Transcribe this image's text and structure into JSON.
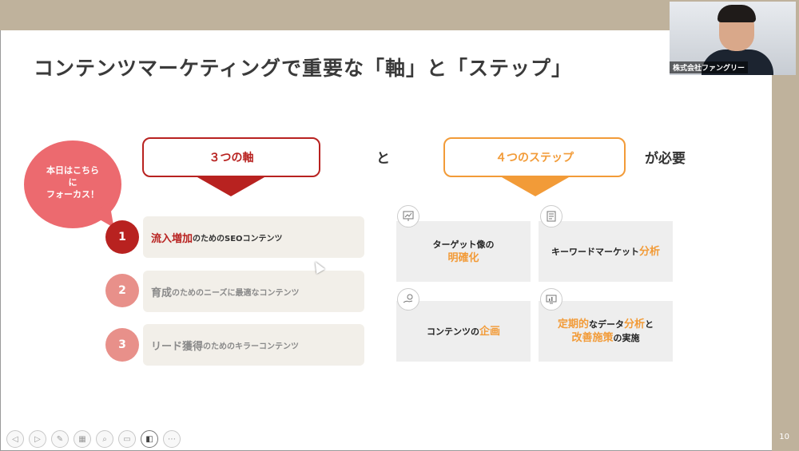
{
  "slide": {
    "title": "コンテンツマーケティングで重要な「軸」と「ステップ」",
    "page_number": "10"
  },
  "video": {
    "name": "株式会社ファングリー"
  },
  "bubble": {
    "line1": "本日はこちら",
    "line2": "に",
    "line3": "フォーカス！"
  },
  "axes": {
    "heading": "３つの軸",
    "items": [
      {
        "number": "1",
        "highlight": "流入増加",
        "rest": "のためのSEOコンテンツ"
      },
      {
        "number": "2",
        "highlight": "育成",
        "rest": "のためのニーズに最適なコンテンツ"
      },
      {
        "number": "3",
        "highlight": "リード獲得",
        "rest": "のためのキラーコンテンツ"
      }
    ]
  },
  "connector": {
    "and": "と",
    "required": "が必要"
  },
  "steps": {
    "heading": "４つのステップ",
    "items": [
      {
        "line1": "ターゲット像の",
        "line2_orange": "明確化"
      },
      {
        "prefix": "キーワードマーケット",
        "orange": "分析"
      },
      {
        "prefix": "コンテンツの",
        "orange": "企画"
      },
      {
        "a_orange": "定期的",
        "b": "なデータ",
        "c_orange": "分析",
        "d": "と",
        "e_orange": "改善施策",
        "f": "の実施"
      }
    ]
  },
  "icons": {
    "step1": "chart-board-icon",
    "step2": "document-icon",
    "step3": "hand-idea-icon",
    "step4": "monitor-chart-icon"
  },
  "colors": {
    "accent_red": "#b82220",
    "accent_orange": "#f29b38",
    "bubble_pink": "#ec6a6f",
    "band_beige": "#bfb29c"
  },
  "controls": [
    "prev",
    "next",
    "pen",
    "grid",
    "zoom",
    "subtitles",
    "camera",
    "more"
  ]
}
